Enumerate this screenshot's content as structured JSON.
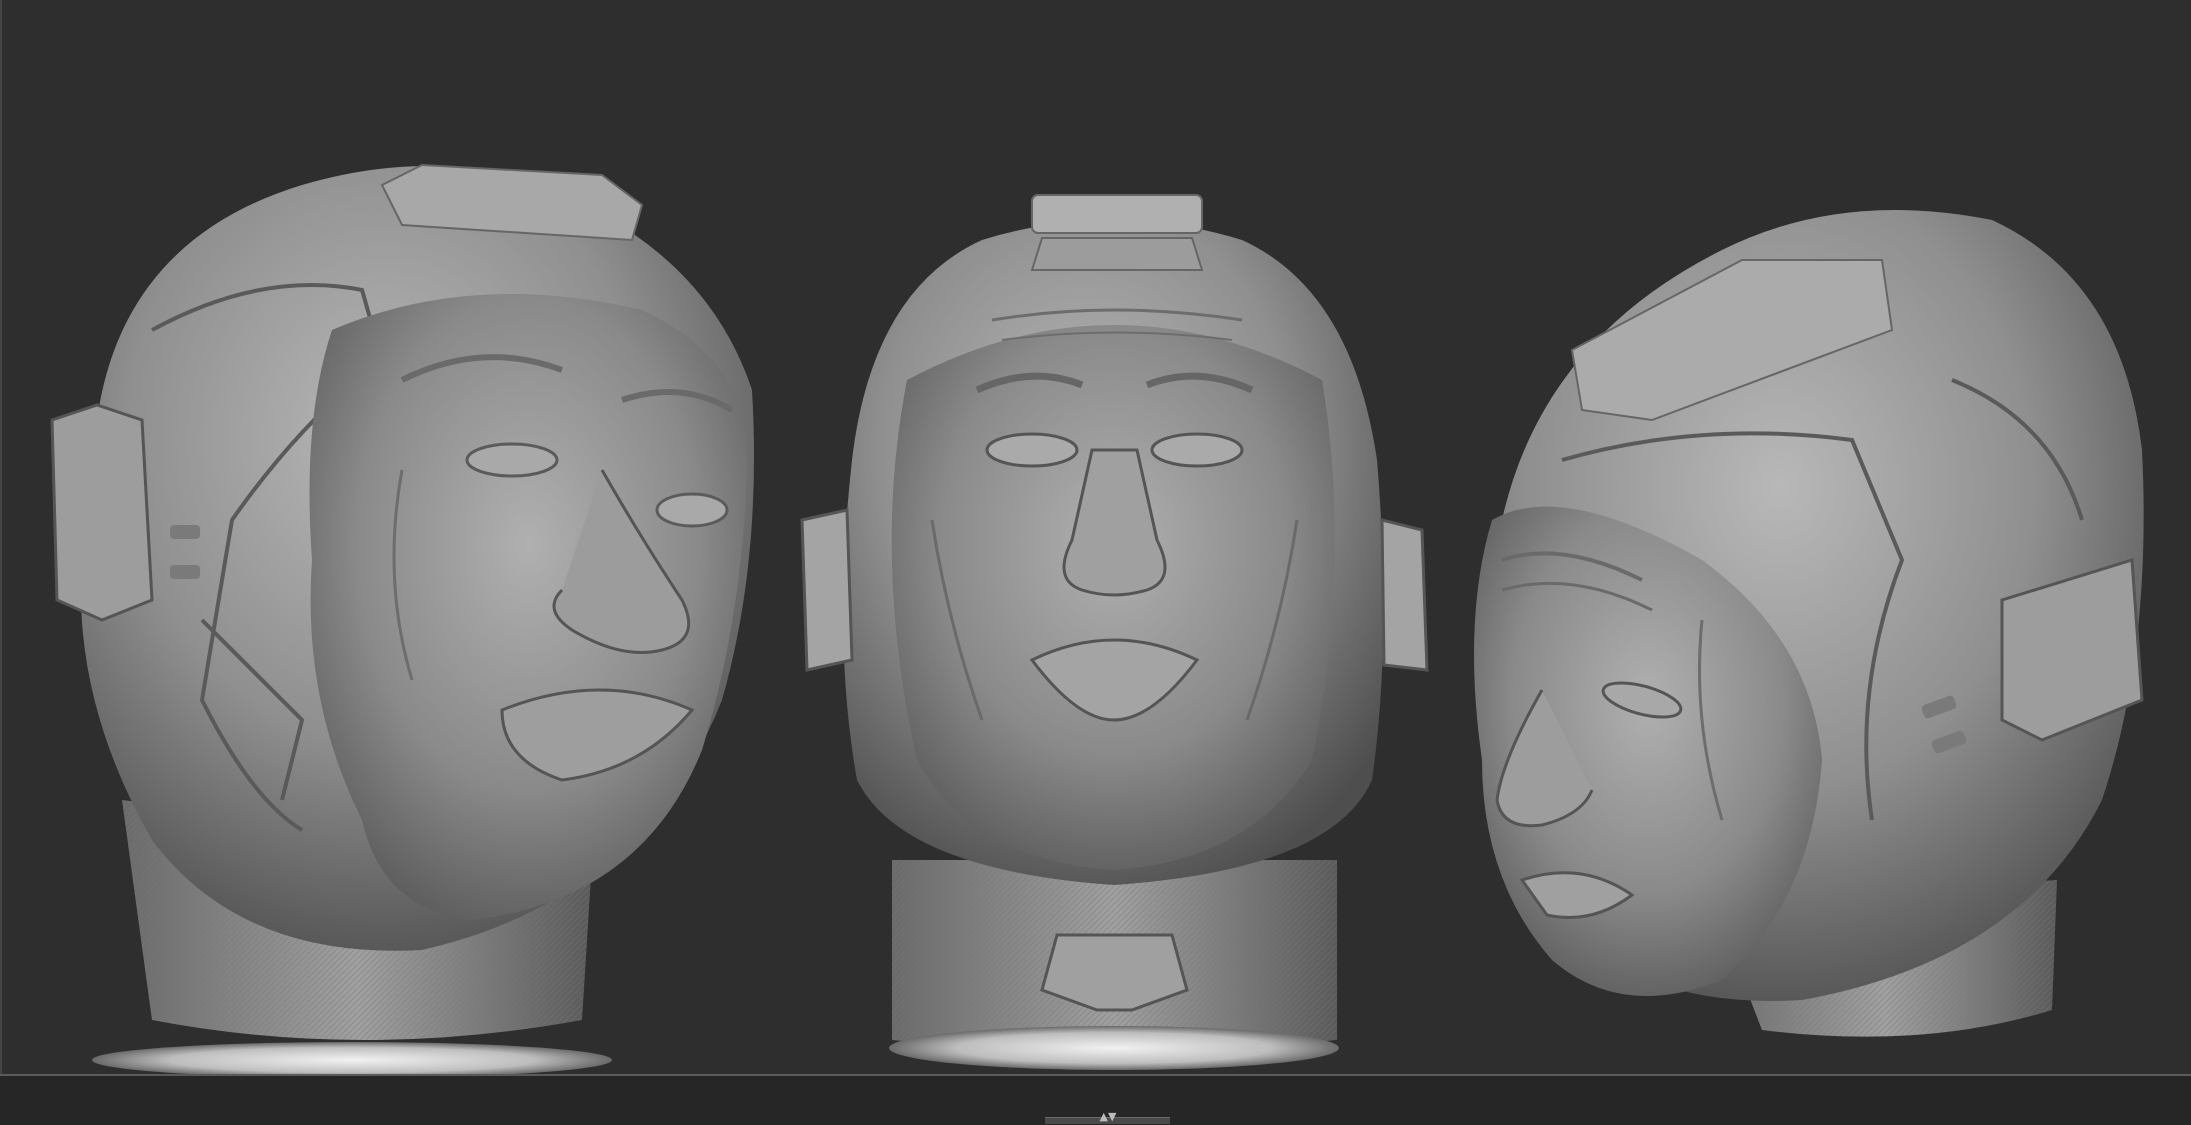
{
  "app": {
    "type": "3d-sculpt-viewport"
  },
  "viewport": {
    "background_color": "#2e2e2e",
    "model_material_color": "#9a9a9a",
    "models": [
      {
        "view": "three-quarter-left",
        "label": ""
      },
      {
        "view": "front",
        "label": ""
      },
      {
        "view": "three-quarter-right-tilted",
        "label": ""
      }
    ]
  },
  "bottom_bar": {
    "handle_icon": "collapse-expand-arrows-icon",
    "handle_glyph": "▲▼"
  }
}
